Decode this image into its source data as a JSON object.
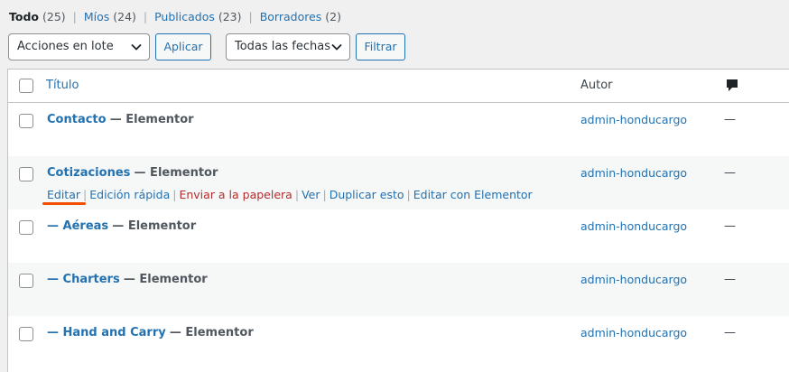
{
  "filters": {
    "all": {
      "label": "Todo",
      "count": "(25)"
    },
    "mine": {
      "label": "Míos",
      "count": "(24)"
    },
    "published": {
      "label": "Publicados",
      "count": "(23)"
    },
    "drafts": {
      "label": "Borradores",
      "count": "(2)"
    },
    "separator": "|"
  },
  "toolbar": {
    "bulk_actions": "Acciones en lote",
    "apply": "Aplicar",
    "dates": "Todas las fechas",
    "filter": "Filtrar"
  },
  "table": {
    "col_title": "Título",
    "col_author": "Autor",
    "comments_icon": "comment-bubble-icon",
    "rows": [
      {
        "title": "Contacto",
        "state": "— Elementor",
        "author": "admin-hondu­cargo",
        "comments": "—"
      },
      {
        "title": "Cotizaciones",
        "state": "— Elementor",
        "author": "admin-honducargo",
        "comments": "—"
      },
      {
        "title": "— Aéreas",
        "state": "— Elementor",
        "author": "admin-honducargo",
        "comments": "—"
      },
      {
        "title": "— Charters",
        "state": "— Elementor",
        "author": "admin-honducargo",
        "comments": "—"
      },
      {
        "title": "— Hand and Carry",
        "state": "— Elementor",
        "author": "admin-honducargo",
        "comments": "—"
      }
    ],
    "row_actions": {
      "edit": "Editar",
      "quick_edit": "Edición rápida",
      "trash": "Enviar a la papelera",
      "view": "Ver",
      "duplicate": "Duplicar esto",
      "edit_elementor": "Editar con Elementor",
      "separator": "|"
    }
  },
  "colors": {
    "link": "#2271b1",
    "trash": "#b32d2e",
    "highlight": "#f34d00"
  }
}
